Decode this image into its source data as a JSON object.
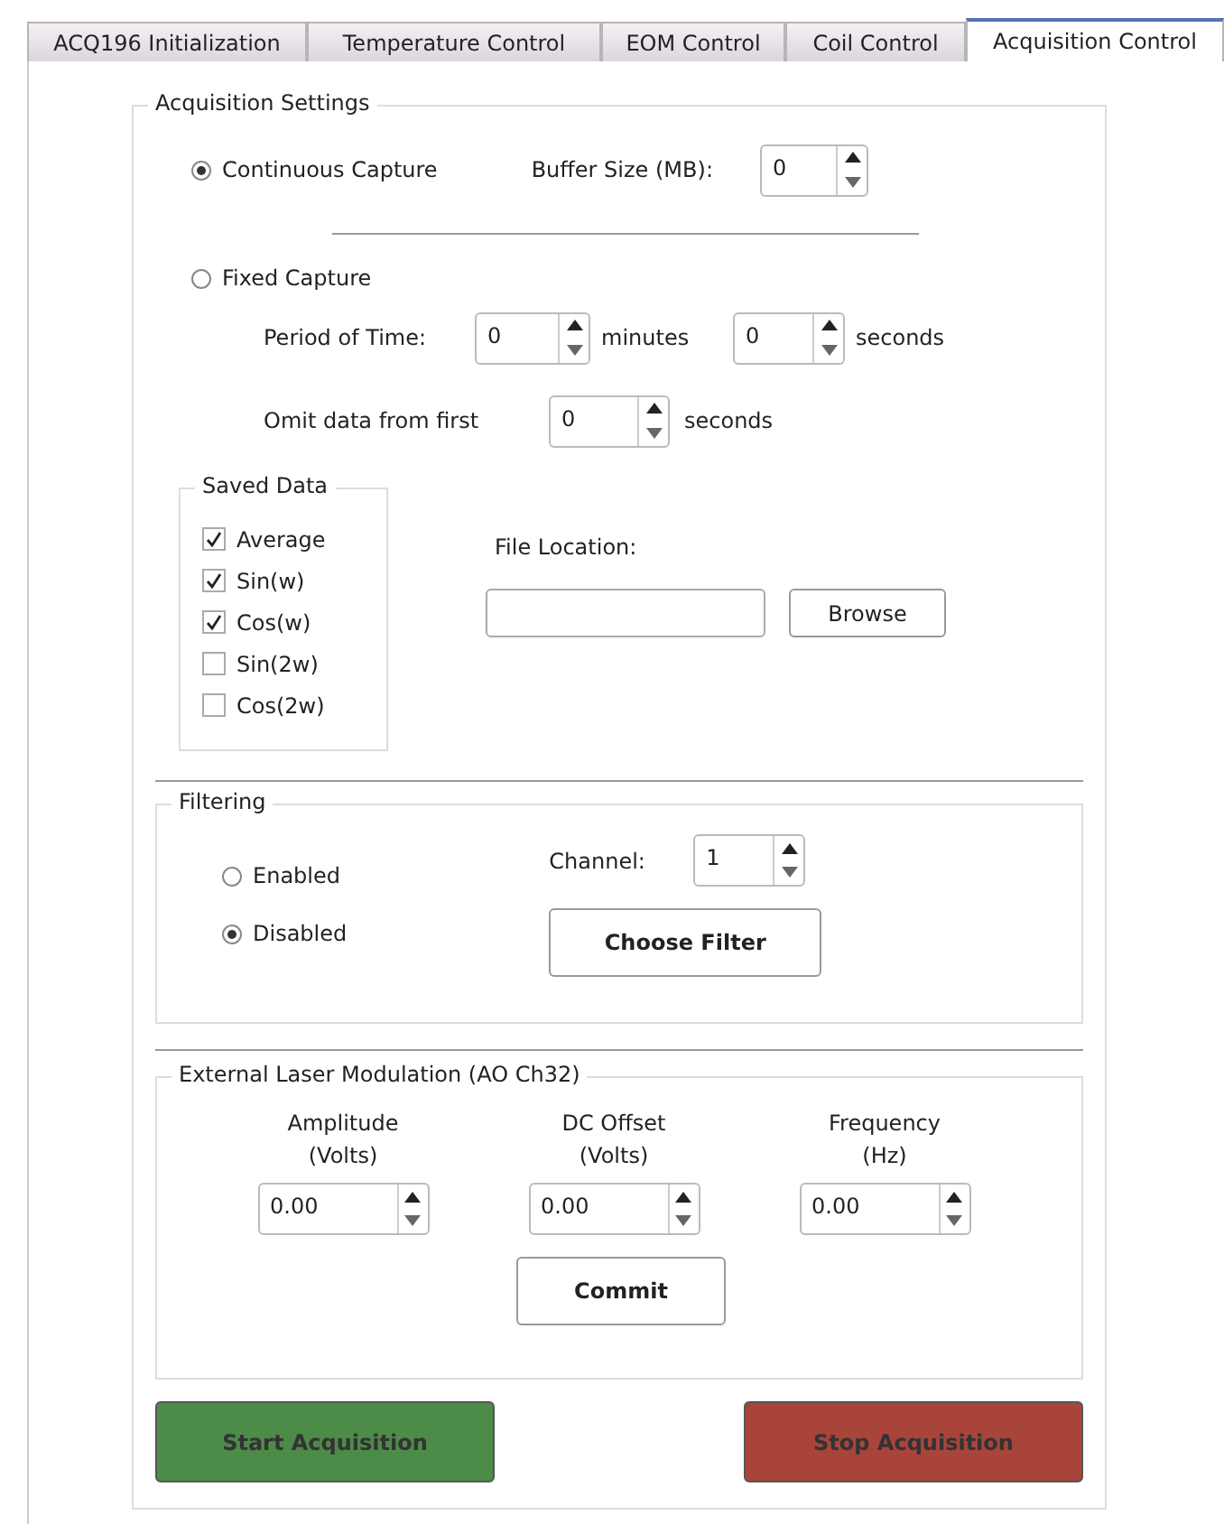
{
  "tabs": [
    {
      "label": "ACQ196 Initialization",
      "selected": false
    },
    {
      "label": "Temperature Control",
      "selected": false
    },
    {
      "label": "EOM Control",
      "selected": false
    },
    {
      "label": "Coil Control",
      "selected": false
    },
    {
      "label": "Acquisition Control",
      "selected": true
    }
  ],
  "acquisition_settings": {
    "title": "Acquisition Settings",
    "continuous": {
      "label": "Continuous Capture",
      "selected": true,
      "buffer_label": "Buffer Size (MB):",
      "buffer_value": "0"
    },
    "fixed": {
      "label": "Fixed Capture",
      "selected": false,
      "period_label": "Period of Time:",
      "minutes_value": "0",
      "minutes_unit": "minutes",
      "seconds_value": "0",
      "seconds_unit": "seconds",
      "omit_label": "Omit data from first",
      "omit_value": "0",
      "omit_unit": "seconds"
    },
    "saved_data": {
      "title": "Saved Data",
      "items": [
        {
          "label": "Average",
          "checked": true
        },
        {
          "label": "Sin(w)",
          "checked": true
        },
        {
          "label": "Cos(w)",
          "checked": true
        },
        {
          "label": "Sin(2w)",
          "checked": false
        },
        {
          "label": "Cos(2w)",
          "checked": false
        }
      ]
    },
    "file_location": {
      "label": "File Location:",
      "button": "Browse"
    }
  },
  "filtering": {
    "title": "Filtering",
    "options": [
      {
        "label": "Enabled",
        "selected": false
      },
      {
        "label": "Disabled",
        "selected": true
      }
    ],
    "channel_label": "Channel:",
    "channel_value": "1",
    "button": "Choose Filter"
  },
  "laser_modulation": {
    "title": "External Laser Modulation (AO Ch32)",
    "fields": [
      {
        "label": "Amplitude",
        "unit": "(Volts)",
        "value": "0.00"
      },
      {
        "label": "DC Offset",
        "unit": "(Volts)",
        "value": "0.00"
      },
      {
        "label": "Frequency",
        "unit": "(Hz)",
        "value": "0.00"
      }
    ],
    "button": "Commit"
  },
  "actions": [
    {
      "label": "Start Acquisition",
      "kind": "start"
    },
    {
      "label": "Stop Acquisition",
      "kind": "stop"
    }
  ]
}
